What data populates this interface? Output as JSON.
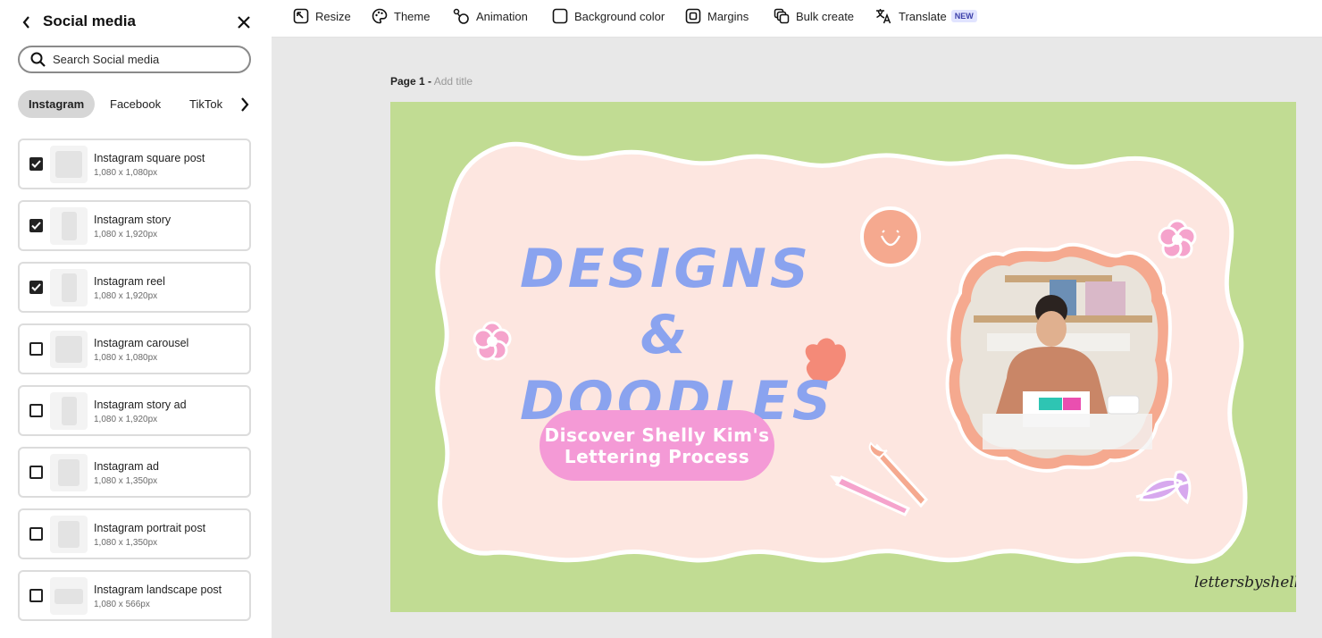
{
  "sidebar": {
    "title": "Social media",
    "search_placeholder": "Search Social media",
    "tabs": [
      {
        "label": "Instagram",
        "active": true
      },
      {
        "label": "Facebook",
        "active": false
      },
      {
        "label": "TikTok",
        "active": false
      }
    ],
    "items": [
      {
        "name": "Instagram square post",
        "size": "1,080 x 1,080px",
        "checked": true,
        "shape": "square"
      },
      {
        "name": "Instagram story",
        "size": "1,080 x 1,920px",
        "checked": true,
        "shape": "tall"
      },
      {
        "name": "Instagram reel",
        "size": "1,080 x 1,920px",
        "checked": true,
        "shape": "tall"
      },
      {
        "name": "Instagram carousel",
        "size": "1,080 x 1,080px",
        "checked": false,
        "shape": "square"
      },
      {
        "name": "Instagram story ad",
        "size": "1,080 x 1,920px",
        "checked": false,
        "shape": "tall"
      },
      {
        "name": "Instagram ad",
        "size": "1,080 x 1,350px",
        "checked": false,
        "shape": "portrait"
      },
      {
        "name": "Instagram portrait post",
        "size": "1,080 x 1,350px",
        "checked": false,
        "shape": "portrait"
      },
      {
        "name": "Instagram landscape post",
        "size": "1,080 x 566px",
        "checked": false,
        "shape": "landscape"
      }
    ]
  },
  "toolbar": {
    "resize": "Resize",
    "theme": "Theme",
    "animation": "Animation",
    "background_color": "Background color",
    "margins": "Margins",
    "bulk_create": "Bulk create",
    "translate": "Translate",
    "translate_badge": "NEW"
  },
  "canvas": {
    "page_label": "Page 1 -",
    "add_title": "Add title",
    "headline_line1": "DESIGNS &",
    "headline_line2": "DOODLES",
    "cta_line1": "Discover Shelly Kim's",
    "cta_line2": "Lettering Process",
    "signature": "lettersbyshells"
  },
  "colors": {
    "outer_green": "#c1dc93",
    "inner_pink": "#fde6e0",
    "headline_blue": "#8aa3ef",
    "cta_pink": "#f49ad6",
    "accent_coral": "#f5a98f",
    "badge_blue": "#3b3fa8"
  },
  "icons": [
    "back-chevron-icon",
    "close-icon",
    "search-icon",
    "chevron-right-icon",
    "resize-icon",
    "theme-palette-icon",
    "animation-icon",
    "background-color-icon",
    "margins-icon",
    "bulk-create-icon",
    "translate-icon",
    "checkbox-check-icon"
  ]
}
